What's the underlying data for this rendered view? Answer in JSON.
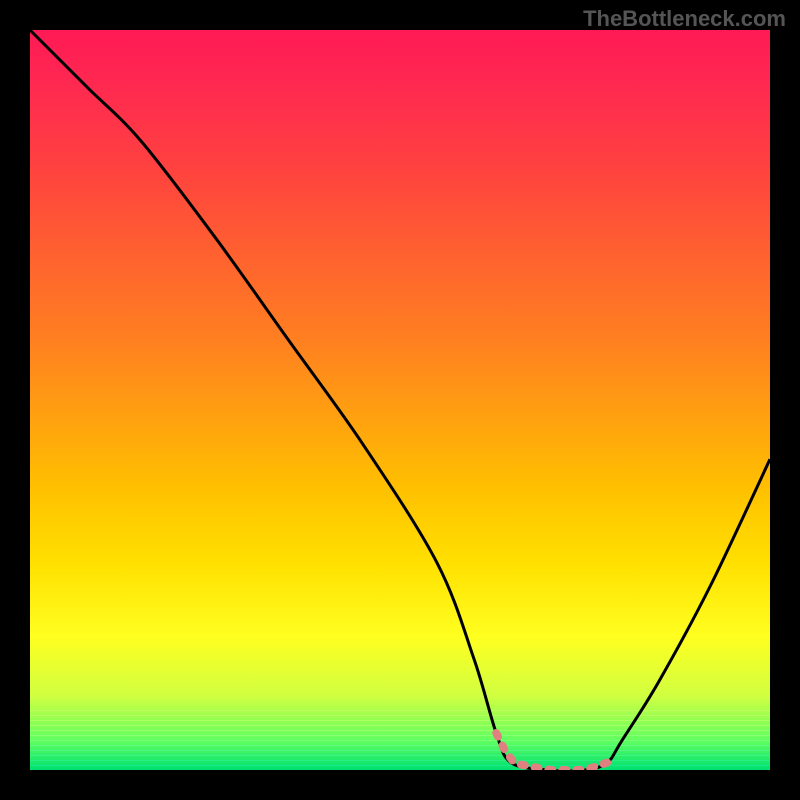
{
  "watermark": "TheBottleneck.com",
  "chart_data": {
    "type": "line",
    "title": "",
    "xlabel": "",
    "ylabel": "",
    "xlim": [
      0,
      100
    ],
    "ylim": [
      0,
      100
    ],
    "grid": false,
    "legend": false,
    "background_gradient": {
      "top": "#ff1a55",
      "middle": "#ffe000",
      "bottom": "#00e070"
    },
    "series": [
      {
        "name": "bottleneck-curve",
        "color": "#000000",
        "x": [
          0,
          3,
          8,
          15,
          25,
          35,
          45,
          55,
          60,
          63,
          65,
          70,
          75,
          78,
          80,
          85,
          92,
          100
        ],
        "y": [
          100,
          97,
          92,
          85,
          72,
          58,
          44,
          28,
          15,
          5,
          1,
          0,
          0,
          1,
          4,
          12,
          25,
          42
        ]
      }
    ],
    "highlight_segment": {
      "name": "optimal-range",
      "color": "#e08080",
      "x_start": 63,
      "x_end": 78,
      "style": "dotted"
    }
  }
}
